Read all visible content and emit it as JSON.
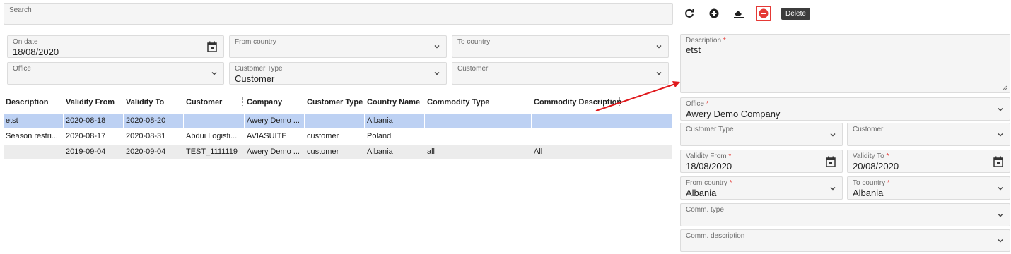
{
  "search": {
    "label": "Search"
  },
  "toolbar": {
    "refresh_icon": "refresh-icon",
    "add_icon": "plus-circle-icon",
    "clear_icon": "eraser-icon",
    "delete_icon": "minus-circle-icon",
    "tooltip": "Delete"
  },
  "filters": {
    "on_date": {
      "label": "On date",
      "value": "18/08/2020"
    },
    "from_country": {
      "label": "From country",
      "value": ""
    },
    "to_country": {
      "label": "To country",
      "value": ""
    },
    "office": {
      "label": "Office",
      "value": ""
    },
    "customer_type": {
      "label": "Customer Type",
      "value": "Customer"
    },
    "customer": {
      "label": "Customer",
      "value": ""
    }
  },
  "table": {
    "columns": [
      "Description",
      "Validity From",
      "Validity To",
      "Customer",
      "Company",
      "Customer Type",
      "Country Name",
      "Commodity Type",
      "Commodity Description"
    ],
    "rows": [
      [
        "etst",
        "2020-08-18",
        "2020-08-20",
        "",
        "Awery Demo ...",
        "",
        "Albania",
        "",
        ""
      ],
      [
        "Season restri...",
        "2020-08-17",
        "2020-08-31",
        "Abdui Logisti...",
        "AVIASUITE",
        "customer",
        "Poland",
        "",
        ""
      ],
      [
        "",
        "2019-09-04",
        "2020-09-04",
        "TEST_1111119",
        "Awery Demo ...",
        "customer",
        "Albania",
        "all",
        "All"
      ]
    ]
  },
  "form": {
    "description": {
      "label": "Description",
      "value": "etst"
    },
    "office": {
      "label": "Office",
      "value": "Awery Demo Company"
    },
    "customer_type": {
      "label": "Customer Type",
      "value": ""
    },
    "customer": {
      "label": "Customer",
      "value": ""
    },
    "validity_from": {
      "label": "Validity From",
      "value": "18/08/2020"
    },
    "validity_to": {
      "label": "Validity To",
      "value": "20/08/2020"
    },
    "from_country": {
      "label": "From country",
      "value": "Albania"
    },
    "to_country": {
      "label": "To country",
      "value": "Albania"
    },
    "comm_type": {
      "label": "Comm. type",
      "value": ""
    },
    "comm_description": {
      "label": "Comm. description",
      "value": ""
    },
    "required_mark": "*"
  },
  "colors": {
    "accent_red": "#e53935",
    "selected_row": "#bdd1f3"
  }
}
